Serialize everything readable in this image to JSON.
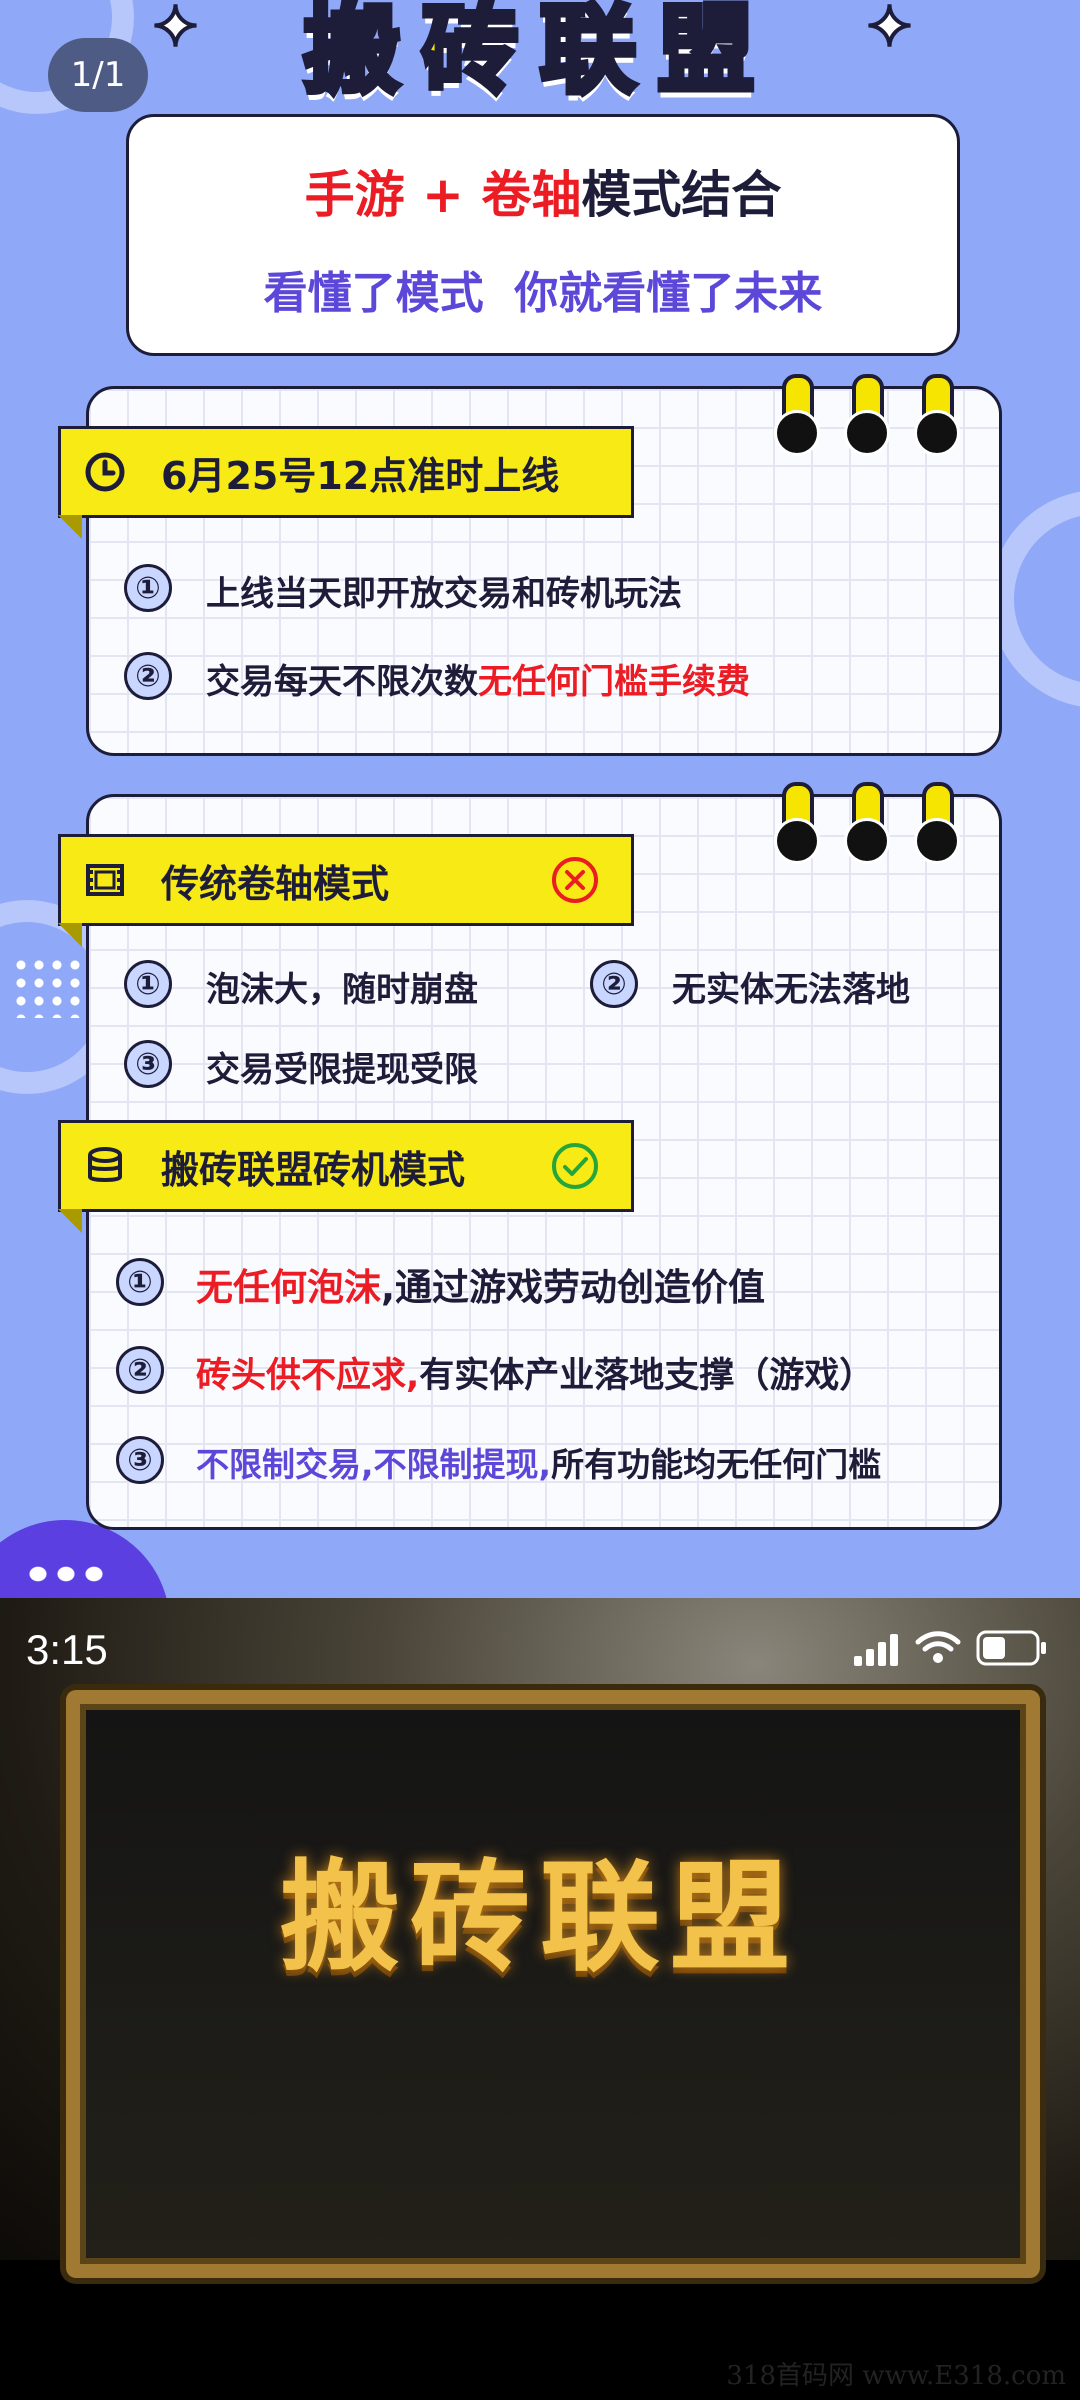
{
  "poster": {
    "title": "搬砖联盟",
    "page_indicator": "1/1",
    "intro": {
      "line1": [
        {
          "text": "手游 + 卷轴",
          "color": "red"
        },
        {
          "text": "模式结合",
          "color": "dark"
        }
      ],
      "line2": "看懂了模式  你就看懂了未来"
    },
    "launch": {
      "banner": "6月25号12点准时上线",
      "banner_icon": "clock-icon",
      "items": [
        {
          "num": "①",
          "parts": [
            {
              "text": "上线当天即开放交易和砖机玩法",
              "color": "dark"
            }
          ]
        },
        {
          "num": "②",
          "parts": [
            {
              "text": "交易每天不限次数",
              "color": "dark"
            },
            {
              "text": "无任何门槛手续费",
              "color": "red"
            }
          ]
        }
      ]
    },
    "traditional": {
      "banner": "传统卷轴模式",
      "banner_icon": "film-icon",
      "status_icon": "cross-circle-icon",
      "items": [
        {
          "num": "①",
          "text": "泡沫大，随时崩盘",
          "color": "dark"
        },
        {
          "num": "②",
          "text": "无实体无法落地",
          "color": "purple"
        },
        {
          "num": "③",
          "text": "交易受限提现受限",
          "color": "dark"
        }
      ]
    },
    "alliance": {
      "banner": "搬砖联盟砖机模式",
      "banner_icon": "database-icon",
      "status_icon": "check-circle-icon",
      "items": [
        {
          "num": "①",
          "parts": [
            {
              "text": "无任何泡沫",
              "color": "red"
            },
            {
              "text": ",通过游戏劳动创造价值",
              "color": "dark"
            }
          ]
        },
        {
          "num": "②",
          "parts": [
            {
              "text": "砖头供不应求,",
              "color": "red"
            },
            {
              "text": "有实体产业落地支撑（游戏）",
              "color": "dark"
            }
          ]
        },
        {
          "num": "③",
          "parts": [
            {
              "text": "不限制交易,不限制提现,",
              "color": "purple"
            },
            {
              "text": "所有功能均无任何门槛",
              "color": "dark"
            }
          ]
        }
      ]
    }
  },
  "phone": {
    "time": "3:15",
    "status_icons": [
      "signal-icon",
      "wifi-icon",
      "battery-icon"
    ],
    "game_title": "搬砖联盟"
  },
  "watermark": "318首码网 www.E318.com",
  "colors": {
    "background": "#8fa8f7",
    "banner_yellow": "#f8ea14",
    "red": "#ec1c24",
    "purple": "#5c48d8",
    "dark": "#1d1d3a",
    "gold": "#f2c24a"
  }
}
